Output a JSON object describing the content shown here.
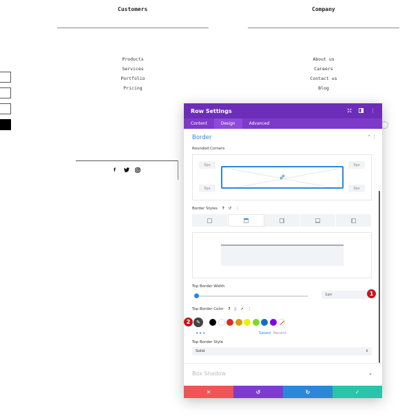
{
  "footer": {
    "col1": {
      "title": "Customers",
      "links": [
        "Products",
        "Services",
        "Portfolio",
        "Pricing"
      ]
    },
    "col2": {
      "title": "Company",
      "links": [
        "About us",
        "Careers",
        "Contact us",
        "Blog"
      ]
    },
    "social_icons": [
      "facebook-icon",
      "twitter-icon",
      "instagram-icon"
    ]
  },
  "modal": {
    "title": "Row Settings",
    "tabs": [
      "Content",
      "Design",
      "Advanced"
    ],
    "active_tab": "Design",
    "section_title": "Border",
    "rounded_corners_label": "Rounded Corners",
    "corners": {
      "top_left": "0px",
      "top_right": "0px",
      "bottom_left": "0px",
      "bottom_right": "0px"
    },
    "border_styles_label": "Border Styles",
    "top_border_width_label": "Top Border Width",
    "top_border_width_value": "1px",
    "top_border_color_label": "Top Border Color",
    "swatches": [
      "#000000",
      "#ffffff",
      "#e02b20",
      "#e09900",
      "#edf000",
      "#7cda24",
      "#0c71c3",
      "#8300e9"
    ],
    "saved_label": "Saved",
    "recent_label": "Recent",
    "top_border_style_label": "Top Border Style",
    "top_border_style_value": "Solid",
    "box_shadow_label": "Box Shadow"
  },
  "badges": {
    "one": "1",
    "two": "2"
  },
  "colors": {
    "header": "#6c2eb9",
    "accent": "#2b87da",
    "cancel": "#ef5555",
    "undo": "#7e3bd0",
    "redo": "#2b87da",
    "save": "#29c4a9",
    "badge": "#c4161c"
  }
}
